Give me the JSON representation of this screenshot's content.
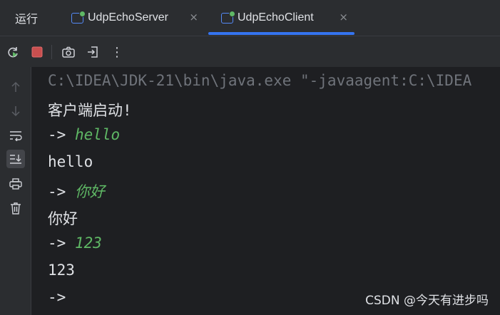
{
  "tabbar": {
    "run_label": "运行",
    "tabs": [
      {
        "label": "UdpEchoServer",
        "close": "×"
      },
      {
        "label": "UdpEchoClient",
        "close": "×"
      }
    ]
  },
  "toolbar": {
    "more": "⋮"
  },
  "console": {
    "command": "C:\\IDEA\\JDK-21\\bin\\java.exe \"-javaagent:C:\\IDEA",
    "lines": [
      {
        "text": "客户端启动!"
      },
      {
        "prompt": "-> ",
        "input": "hello"
      },
      {
        "text": "hello"
      },
      {
        "prompt": "-> ",
        "input": "你好"
      },
      {
        "text": "你好"
      },
      {
        "prompt": "-> ",
        "input": "123"
      },
      {
        "text": "123"
      },
      {
        "prompt": "->",
        "input": ""
      }
    ]
  },
  "watermark": "CSDN @今天有进步吗",
  "colors": {
    "accent": "#3574f0",
    "input_text": "#5fb865",
    "stop_red": "#c94f4f"
  }
}
